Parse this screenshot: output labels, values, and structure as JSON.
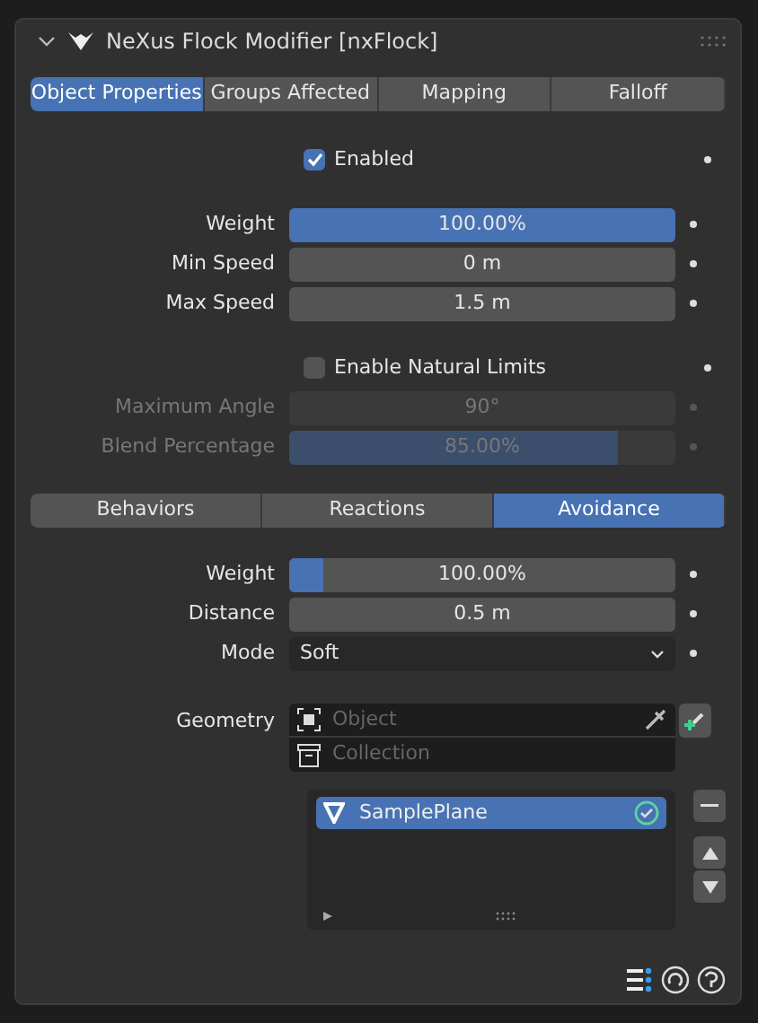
{
  "panel": {
    "title": "NeXus Flock Modifier [nxFlock]",
    "expanded": true
  },
  "tabs": [
    {
      "label": "Object Properties",
      "selected": true
    },
    {
      "label": "Groups Affected",
      "selected": false
    },
    {
      "label": "Mapping",
      "selected": false
    },
    {
      "label": "Falloff",
      "selected": false
    }
  ],
  "enabled": {
    "label": "Enabled",
    "checked": true
  },
  "speed_fields": [
    {
      "label": "Weight",
      "value": "100.00%",
      "kind": "slider",
      "level": 1.0,
      "disabled": false
    },
    {
      "label": "Min Speed",
      "value": "0 m",
      "kind": "number",
      "disabled": false
    },
    {
      "label": "Max Speed",
      "value": "1.5 m",
      "kind": "number",
      "disabled": false
    }
  ],
  "natural_limits": {
    "label": "Enable Natural Limits",
    "checked": false
  },
  "limit_fields": [
    {
      "label": "Maximum Angle",
      "value": "90°",
      "kind": "number",
      "disabled": true
    },
    {
      "label": "Blend Percentage",
      "value": "85.00%",
      "kind": "slider",
      "level": 0.85,
      "disabled": true
    }
  ],
  "sub_tabs": [
    {
      "label": "Behaviors",
      "selected": false
    },
    {
      "label": "Reactions",
      "selected": false
    },
    {
      "label": "Avoidance",
      "selected": true
    }
  ],
  "avoidance_fields": [
    {
      "label": "Weight",
      "value": "100.00%",
      "kind": "slider",
      "level": 0.09,
      "disabled": false
    },
    {
      "label": "Distance",
      "value": "0.5 m",
      "kind": "number",
      "disabled": false
    },
    {
      "label": "Mode",
      "value": "Soft",
      "kind": "dropdown",
      "disabled": false
    }
  ],
  "geometry": {
    "label": "Geometry",
    "object_placeholder": "Object",
    "collection_placeholder": "Collection"
  },
  "list": {
    "items": [
      {
        "label": "SamplePlane",
        "selected": true
      }
    ]
  }
}
